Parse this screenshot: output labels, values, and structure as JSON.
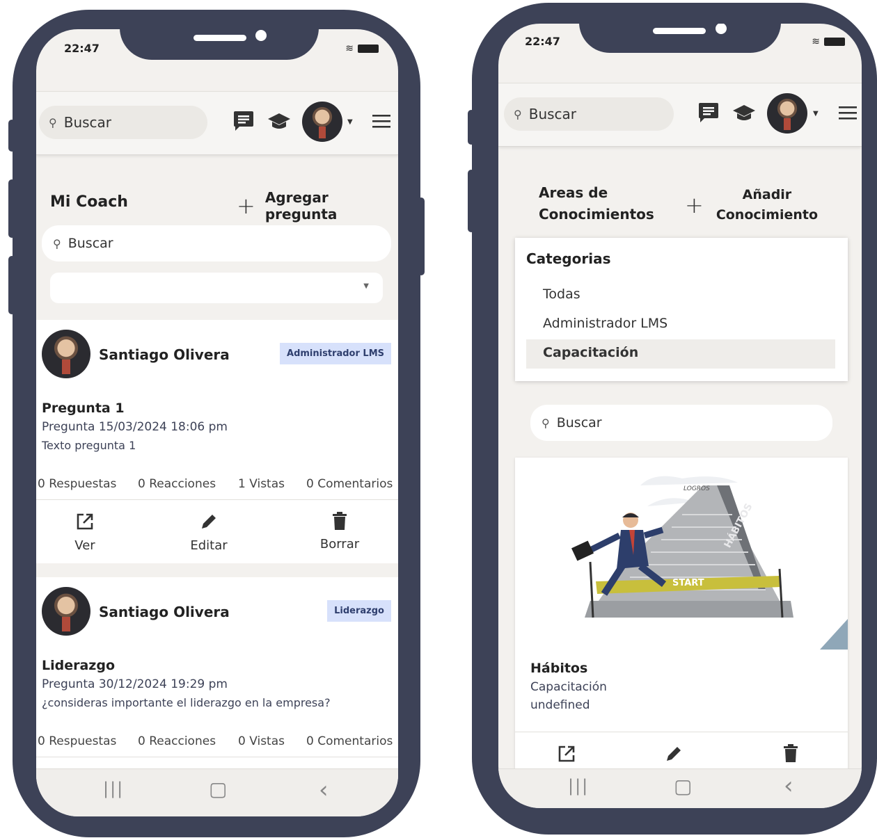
{
  "left_phone": {
    "time": "22:47",
    "header": {
      "search_label": "Buscar"
    },
    "page_title": "Mi Coach",
    "add_question_label": "Agregar pregunta",
    "add_icon": "+",
    "filter_search_label": "Buscar",
    "posts": [
      {
        "author": "Santiago Olivera",
        "badge": "Administrador LMS",
        "title": "Pregunta 1",
        "meta": "Pregunta 15/03/2024 18:06 pm",
        "text": "Texto pregunta 1",
        "stats": {
          "answers": "0 Respuestas",
          "reactions": "0 Reacciones",
          "views": "1 Vistas",
          "comments": "0 Comentarios"
        },
        "actions": {
          "view": "Ver",
          "edit": "Editar",
          "delete": "Borrar"
        }
      },
      {
        "author": "Santiago Olivera",
        "badge": "Liderazgo",
        "title": "Liderazgo",
        "meta": "Pregunta 30/12/2024 19:29 pm",
        "text": "¿consideras importante el liderazgo en la empresa?",
        "stats": {
          "answers": "0 Respuestas",
          "reactions": "0 Reacciones",
          "views": "0 Vistas",
          "comments": "0 Comentarios"
        }
      }
    ],
    "nav": {
      "recents": "|||",
      "home": "▢",
      "back": "‹"
    }
  },
  "right_phone": {
    "time": "22:47",
    "header": {
      "search_label": "Buscar"
    },
    "page_title_line1": "Areas de",
    "page_title_line2": "Conocimientos",
    "add_icon": "+",
    "add_label_line1": "Añadir",
    "add_label_line2": "Conocimiento",
    "categories_title": "Categorias",
    "categories": [
      "Todas",
      "Administrador LMS",
      "Capacitación"
    ],
    "selected_category": "Capacitación",
    "filter_search_label": "Buscar",
    "knowledge_card": {
      "image_text_top": "LOGROS",
      "image_text_steps": "HÁBITOS",
      "image_text_banner": "START",
      "title": "Hábitos",
      "category": "Capacitación",
      "description": "undefined"
    },
    "nav": {
      "recents": "|||",
      "home": "▢",
      "back": "‹"
    }
  },
  "icons": {
    "search": "search-icon",
    "chat": "chat-icon",
    "graduation": "graduation-cap-icon",
    "menu": "hamburger-menu-icon",
    "view": "open-external-icon",
    "edit": "pencil-icon",
    "delete": "trash-icon"
  },
  "colors": {
    "phone_frame": "#3d4257",
    "screen_bg": "#f3f1ee",
    "badge_bg": "#d7e1fb",
    "badge_text": "#2f3f6e"
  }
}
